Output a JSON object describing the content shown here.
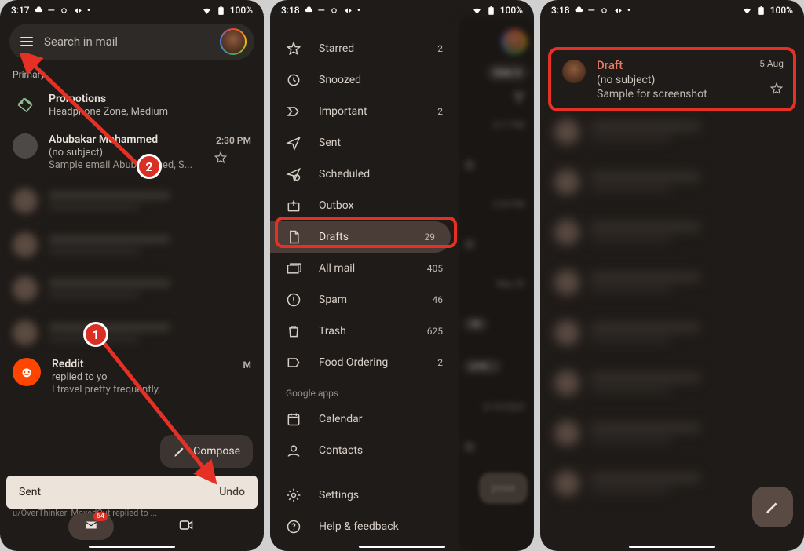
{
  "phone1": {
    "status": {
      "time": "3:17",
      "battery": "100%"
    },
    "search_placeholder": "Search in mail",
    "section": "Primary",
    "promotions": {
      "title": "Promotions",
      "subtitle": "Headphone Zone, Medium"
    },
    "thread": {
      "sender": "Abubakar Mohammed",
      "subject": "(no subject)",
      "snippet": "Sample email Abuba          mmed, S...",
      "time": "2:30 PM"
    },
    "reddit": {
      "sender": "Reddit",
      "line2": "replied to yo",
      "snippet": "I travel pretty frequently,",
      "time": "M"
    },
    "compose": "Compose",
    "toast": {
      "msg": "Sent",
      "action": "Undo"
    },
    "overflow": "u/OverThinker_MaxedOut replied to ...",
    "badge": "64",
    "callouts": {
      "one": "1",
      "two": "2"
    }
  },
  "phone2": {
    "status": {
      "time": "3:18",
      "battery": "100%"
    },
    "items": [
      {
        "icon": "star",
        "label": "Starred",
        "count": "2"
      },
      {
        "icon": "clock",
        "label": "Snoozed",
        "count": ""
      },
      {
        "icon": "important",
        "label": "Important",
        "count": "2"
      },
      {
        "icon": "sent",
        "label": "Sent",
        "count": ""
      },
      {
        "icon": "scheduled",
        "label": "Scheduled",
        "count": ""
      },
      {
        "icon": "outbox",
        "label": "Outbox",
        "count": ""
      },
      {
        "icon": "draft",
        "label": "Drafts",
        "count": "29"
      },
      {
        "icon": "allmail",
        "label": "All mail",
        "count": "405"
      },
      {
        "icon": "spam",
        "label": "Spam",
        "count": "46"
      },
      {
        "icon": "trash",
        "label": "Trash",
        "count": "625"
      },
      {
        "icon": "label",
        "label": "Food Ordering",
        "count": "2"
      }
    ],
    "google_apps": "Google apps",
    "calendar": "Calendar",
    "contacts": "Contacts",
    "settings": "Settings",
    "help": "Help & feedback",
    "date_pill": "Date",
    "times": [
      "3:17 PM",
      "2:39 PM",
      "May 20",
      "Up",
      "g Gal...",
      "6/14/2023",
      "6/14/2023"
    ],
    "compose": "pose"
  },
  "phone3": {
    "status": {
      "time": "3:18",
      "battery": "100%"
    },
    "draft": {
      "title": "Draft",
      "subject": "(no subject)",
      "snippet": "Sample for screenshot",
      "date": "5 Aug"
    }
  }
}
